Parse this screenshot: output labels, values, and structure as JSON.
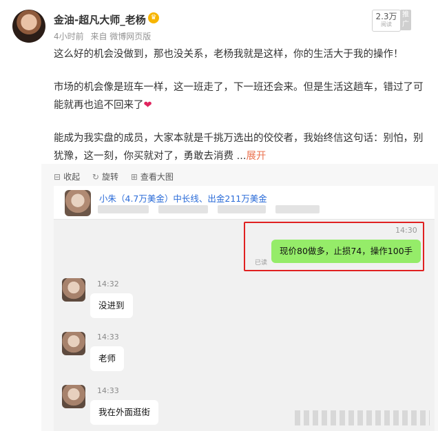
{
  "post": {
    "author": "金油-超凡大师_老杨",
    "time": "4小时前",
    "source": "来自 微博网页版",
    "views": "2.3万",
    "views_label": "阅读",
    "promo": "推广",
    "para1": "这么好的机会没做到，那也没关系，老杨我就是这样，你的生活大于我的操作！",
    "para2": "市场的机会像是班车一样，这一班走了，下一班还会来。但是生活这趟车，错过了可能就再也追不回来了",
    "heart": "❤",
    "para3": "能成为我实盘的成员，大家本就是千挑万选出的佼佼者，我始终信这句话：别怕，别犹豫，这一刻，你买就对了，勇敢去消费",
    "ellipsis": "...",
    "expand": "展开"
  },
  "image_toolbar": {
    "collapse": "收起",
    "rotate": "旋转",
    "view_large": "查看大图"
  },
  "chat": {
    "title": "小朱（4.7万美金）中长线、出金211万美金",
    "sent": {
      "time": "14:30",
      "text": "现价80做多，止损74，操作100手",
      "read": "已读"
    },
    "messages": [
      {
        "time": "14:32",
        "text": "没进到"
      },
      {
        "time": "14:33",
        "text": "老师"
      },
      {
        "time": "14:33",
        "text": "我在外面逛街"
      }
    ]
  },
  "colors": {
    "accent": "#eb7350",
    "link_blue": "#2a6bd8",
    "highlight_red": "#e02020",
    "sent_bubble": "#95ec69"
  }
}
